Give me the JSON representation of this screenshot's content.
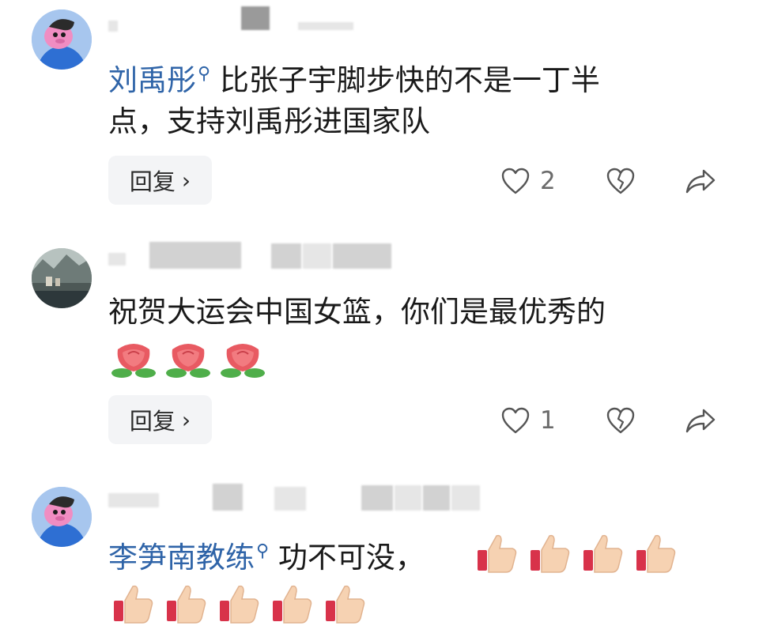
{
  "comments": [
    {
      "author": "刘禹彤",
      "text_line1": "比张子宇脚步快的不是一丁半",
      "text_line2": "点，支持刘禹彤进国家队",
      "reply_label": "回复",
      "likes": "2"
    },
    {
      "text": "祝贺大运会中国女篮，你们是最优秀的",
      "reply_label": "回复",
      "likes": "1"
    },
    {
      "author": "李笋南教练",
      "text": "功不可没，"
    }
  ],
  "icons": {
    "reply_chevron": "›",
    "author_badge": "⚲"
  }
}
